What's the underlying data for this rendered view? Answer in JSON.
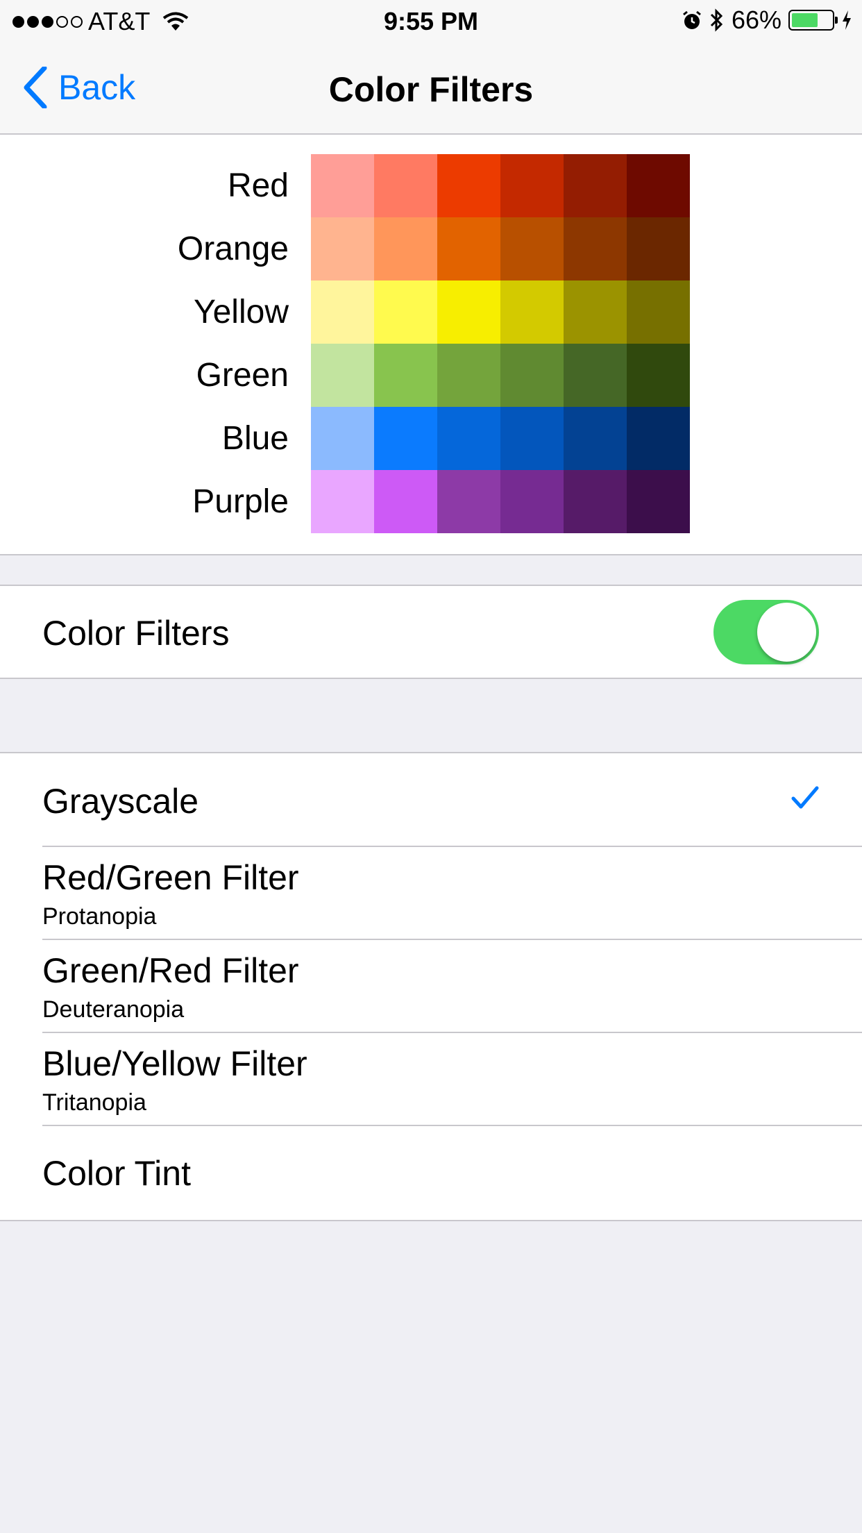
{
  "status_bar": {
    "carrier": "AT&T",
    "time": "9:55 PM",
    "battery_percent": "66%",
    "battery_level": 0.66,
    "icons": [
      "signal-dots",
      "wifi-icon",
      "alarm-icon",
      "bluetooth-icon",
      "battery-icon",
      "charging-bolt-icon"
    ]
  },
  "nav": {
    "back_label": "Back",
    "title": "Color Filters"
  },
  "preview": {
    "rows": [
      {
        "label": "Red",
        "colors": [
          "#ff9e97",
          "#ff7a62",
          "#ec3b00",
          "#c42900",
          "#941d02",
          "#6e0a00"
        ]
      },
      {
        "label": "Orange",
        "colors": [
          "#ffb48f",
          "#ff965a",
          "#e26300",
          "#b85000",
          "#8d3700",
          "#6b2700"
        ]
      },
      {
        "label": "Yellow",
        "colors": [
          "#fff59c",
          "#fffa4e",
          "#f7ee00",
          "#d3ca00",
          "#9b9300",
          "#777000"
        ]
      },
      {
        "label": "Green",
        "colors": [
          "#c2e49f",
          "#88c44e",
          "#74a43c",
          "#608a31",
          "#456726",
          "#30490d"
        ]
      },
      {
        "label": "Blue",
        "colors": [
          "#8bbafe",
          "#0b7bfe",
          "#0567da",
          "#0356bc",
          "#034293",
          "#022b66"
        ]
      },
      {
        "label": "Purple",
        "colors": [
          "#e9a6ff",
          "#cd5af6",
          "#8d3aa7",
          "#762b92",
          "#561b68",
          "#3c0e4b"
        ]
      }
    ]
  },
  "toggle_cell": {
    "label": "Color Filters",
    "on": true,
    "on_color": "#4cd964"
  },
  "filters": {
    "selected": "Grayscale",
    "accent_color": "#007aff",
    "items": [
      {
        "title": "Grayscale",
        "subtitle": ""
      },
      {
        "title": "Red/Green Filter",
        "subtitle": "Protanopia"
      },
      {
        "title": "Green/Red Filter",
        "subtitle": "Deuteranopia"
      },
      {
        "title": "Blue/Yellow Filter",
        "subtitle": "Tritanopia"
      },
      {
        "title": "Color Tint",
        "subtitle": ""
      }
    ]
  }
}
